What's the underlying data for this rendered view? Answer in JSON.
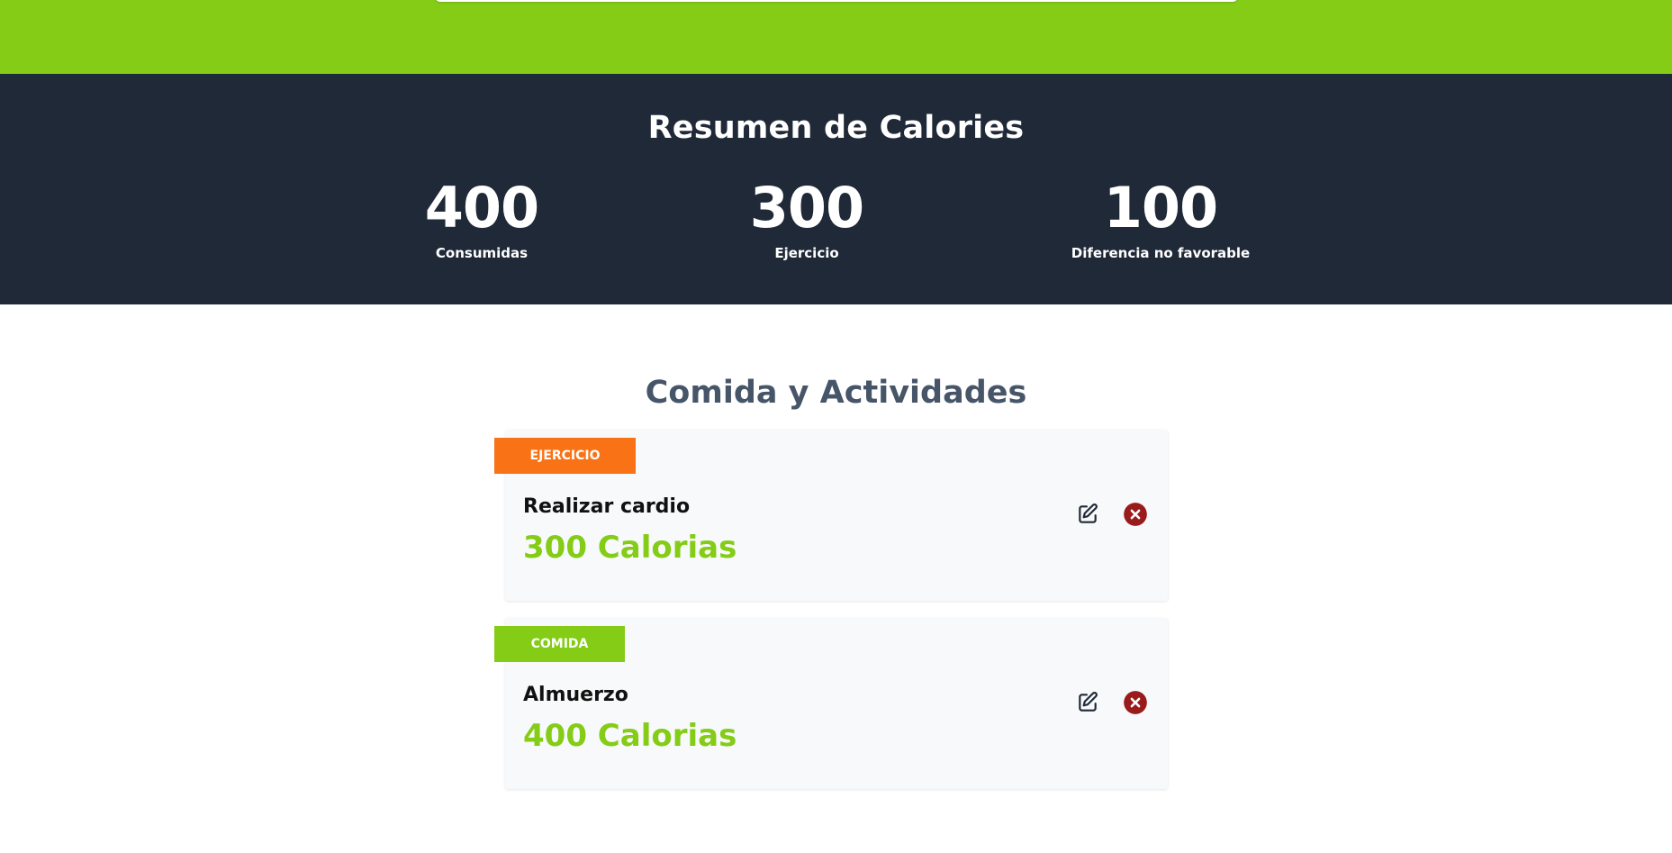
{
  "summary": {
    "title": "Resumen de Calories",
    "stats": [
      {
        "value": "400",
        "label": "Consumidas"
      },
      {
        "value": "300",
        "label": "Ejercicio"
      },
      {
        "value": "100",
        "label": "Diferencia no favorable"
      }
    ]
  },
  "activities": {
    "title": "Comida y Actividades",
    "items": [
      {
        "category": "Ejercicio",
        "category_color": "#f97316",
        "name": "Realizar cardio",
        "calories": "300 Calorias"
      },
      {
        "category": "Comida",
        "category_color": "#84cc16",
        "name": "Almuerzo",
        "calories": "400 Calorias"
      }
    ]
  },
  "icons": {
    "edit": "pencil-square-icon",
    "delete": "x-circle-icon"
  },
  "colors": {
    "brand_green": "#84cc16",
    "dark_band": "#1f2937",
    "exercise_orange": "#f97316",
    "delete_red": "#991b1b",
    "heading_slate": "#475569"
  }
}
